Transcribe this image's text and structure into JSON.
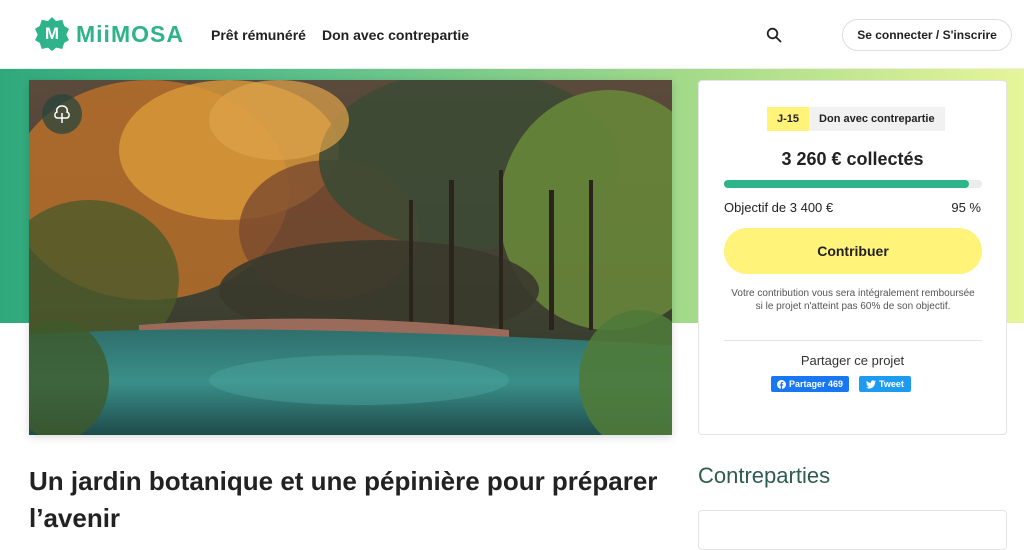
{
  "brand": {
    "logo_letter": "M",
    "name": "MiiMOSA"
  },
  "nav": {
    "items": [
      "Prêt rémunéré",
      "Don avec contrepartie"
    ],
    "login_label": "Se connecter / S'inscrire"
  },
  "icons": {
    "search": "search-icon",
    "tree": "tree-icon",
    "facebook": "facebook-icon",
    "twitter": "twitter-icon"
  },
  "colors": {
    "brand": "#2fb388",
    "accent": "#fff37a"
  },
  "campaign": {
    "days_left": "J-15",
    "type": "Don avec contrepartie",
    "collected": "3 260 € collectés",
    "goal": "Objectif de 3 400 €",
    "percent_label": "95 %",
    "progress": 0.95,
    "contribute_label": "Contribuer",
    "note": "Votre contribution vous sera intégralement remboursée si le projet n'atteint pas 60% de son objectif.",
    "share_title": "Partager ce projet",
    "facebook_label": "Partager 469",
    "twitter_label": "Tweet"
  },
  "project": {
    "title": "Un jardin botanique et une pépinière pour préparer l’avenir"
  },
  "rewards": {
    "title": "Contreparties"
  }
}
